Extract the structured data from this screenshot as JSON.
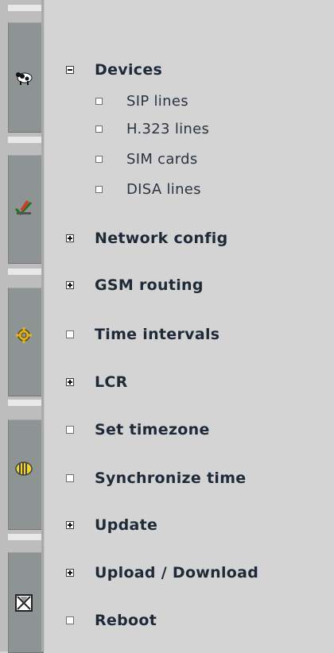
{
  "rail": {
    "buttons": [
      {
        "icon": "cow-icon"
      },
      {
        "icon": "pencil-check-icon"
      },
      {
        "icon": "gear-icon"
      },
      {
        "icon": "coin-stack-icon"
      },
      {
        "icon": "hourglass-icon"
      }
    ]
  },
  "tree": {
    "devices": {
      "label": "Devices",
      "expanded": true,
      "children": [
        "SIP lines",
        "H.323 lines",
        "SIM cards",
        "DISA lines"
      ]
    },
    "items": [
      {
        "label": "Network config",
        "state": "collapsed"
      },
      {
        "label": "GSM routing",
        "state": "collapsed"
      },
      {
        "label": "Time intervals",
        "state": "leaf"
      },
      {
        "label": "LCR",
        "state": "collapsed"
      },
      {
        "label": "Set timezone",
        "state": "leaf"
      },
      {
        "label": "Synchronize time",
        "state": "leaf"
      },
      {
        "label": "Update",
        "state": "collapsed"
      },
      {
        "label": "Upload / Download",
        "state": "collapsed"
      },
      {
        "label": "Reboot",
        "state": "leaf"
      }
    ]
  }
}
